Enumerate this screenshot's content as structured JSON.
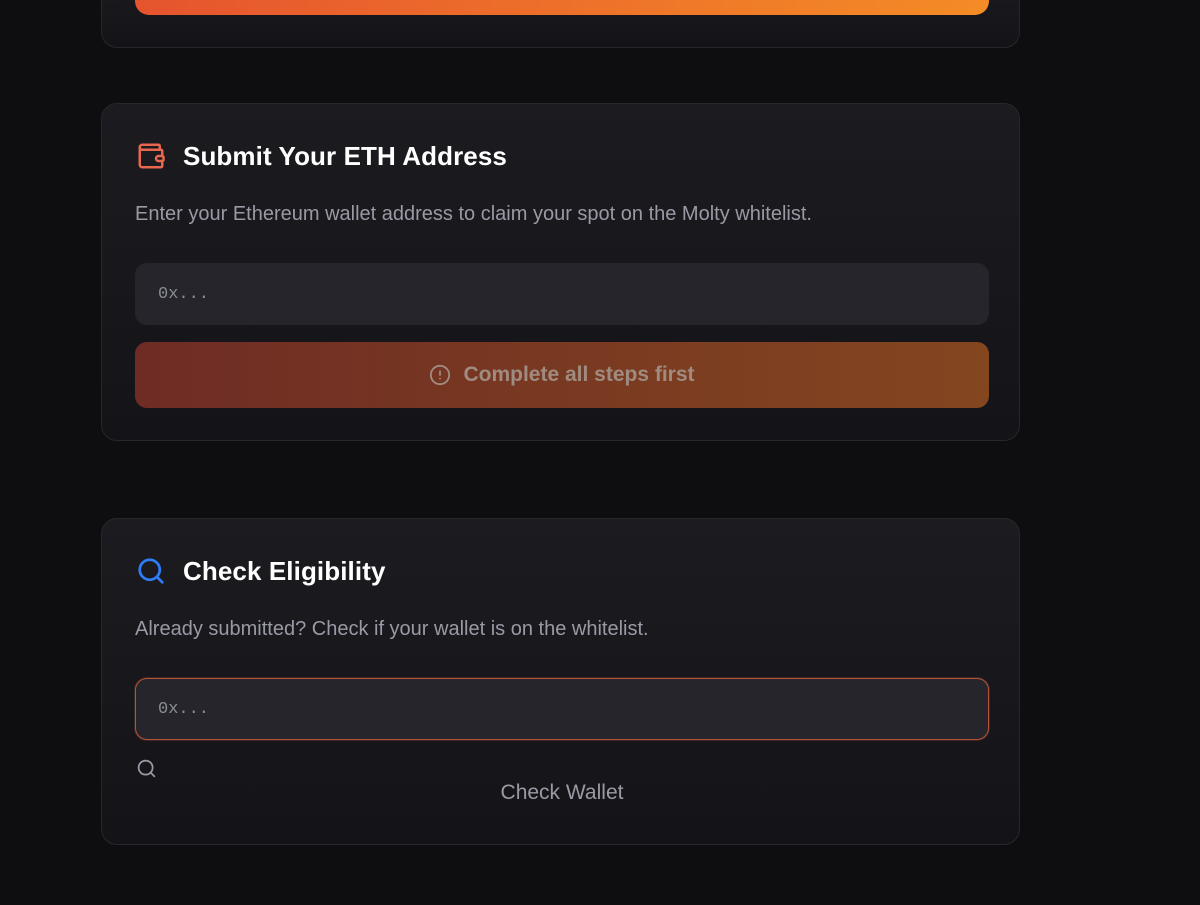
{
  "colors": {
    "background": "#0e0e10",
    "card": "#1b1b20",
    "accent_orange": "#f48c26",
    "accent_red": "#e6542e",
    "wallet_icon": "#e8674f",
    "search_icon": "#2f7cf6"
  },
  "submit_section": {
    "icon": "wallet-icon",
    "title": "Submit Your ETH Address",
    "description": "Enter your Ethereum wallet address to claim your spot on the Molty whitelist.",
    "input_placeholder": "0x...",
    "input_value": "",
    "button_icon": "alert-circle-icon",
    "button_label": "Complete all steps first"
  },
  "check_section": {
    "icon": "search-icon",
    "title": "Check Eligibility",
    "description": "Already submitted? Check if your wallet is on the whitelist.",
    "input_placeholder": "0x...",
    "input_value": "",
    "button_icon": "search-icon",
    "button_label": "Check Wallet"
  }
}
